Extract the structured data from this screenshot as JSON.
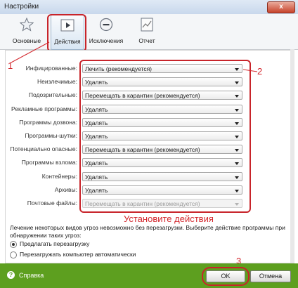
{
  "window": {
    "title": "Настройки",
    "close_glyph": "x"
  },
  "toolbar": {
    "tools": [
      {
        "label": "Основные",
        "icon": "star-icon"
      },
      {
        "label": "Действия",
        "icon": "play-icon"
      },
      {
        "label": "Исключения",
        "icon": "minus-circle-icon"
      },
      {
        "label": "Отчет",
        "icon": "report-chart-icon"
      }
    ],
    "active": "Действия"
  },
  "annotations": {
    "step1": "1",
    "step2": "2",
    "step3": "3",
    "hint": "Установите действия"
  },
  "actions": [
    {
      "label": "Инфицированные:",
      "value": "Лечить (рекомендуется)",
      "enabled": true
    },
    {
      "label": "Неизлечимые:",
      "value": "Удалять",
      "enabled": true
    },
    {
      "label": "Подозрительные:",
      "value": "Перемещать в карантин (рекомендуется)",
      "enabled": true
    },
    {
      "label": "Рекламные программы:",
      "value": "Удалять",
      "enabled": true
    },
    {
      "label": "Программы дозвона:",
      "value": "Удалять",
      "enabled": true
    },
    {
      "label": "Программы-шутки:",
      "value": "Удалять",
      "enabled": true
    },
    {
      "label": "Потенциально опасные:",
      "value": "Перемещать в карантин (рекомендуется)",
      "enabled": true
    },
    {
      "label": "Программы взлома:",
      "value": "Удалять",
      "enabled": true
    },
    {
      "label": "Контейнеры:",
      "value": "Удалять",
      "enabled": true
    },
    {
      "label": "Архивы:",
      "value": "Удалять",
      "enabled": true
    },
    {
      "label": "Почтовые файлы:",
      "value": "Перемещать в карантин (рекомендуется)",
      "enabled": false
    }
  ],
  "reboot": {
    "note": "Лечение некоторых видов угроз невозможно без перезагрузки. Выберите действие программы при обнаружении таких угроз:",
    "options": [
      {
        "label": "Предлагать перезагрузку",
        "selected": true
      },
      {
        "label": "Перезагружать компьютер автоматически",
        "selected": false
      }
    ]
  },
  "footer": {
    "help_label": "Справка",
    "ok_label": "OK",
    "cancel_label": "Отмена",
    "accent": "#5d9f1f"
  },
  "colors": {
    "annotation_red": "#d3262c"
  }
}
